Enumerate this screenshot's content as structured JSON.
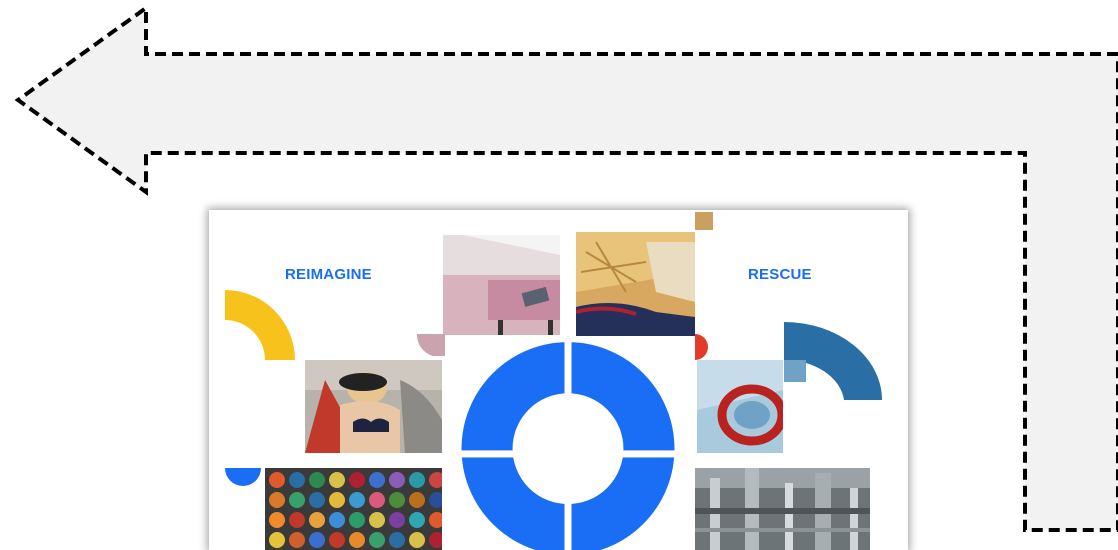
{
  "labels": {
    "left": "REIMAGINE",
    "right": "RESCUE"
  },
  "colors": {
    "arrow_fill": "#f2f2f2",
    "arrow_stroke": "#000000",
    "brand_blue": "#1a6ef5",
    "yellow": "#f7c21b",
    "steel_blue": "#2a6ea6",
    "tan": "#c9a05f",
    "red": "#e23b2a"
  },
  "icons": [
    "dashed-arrow-left-icon",
    "ring-icon",
    "quarter-arc-icon"
  ]
}
